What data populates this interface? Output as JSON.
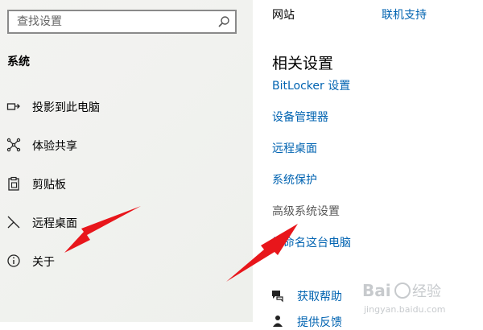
{
  "search": {
    "placeholder": "查找设置"
  },
  "sidebar": {
    "section_title": "系统",
    "items": [
      {
        "label": "投影到此电脑",
        "icon": "project-icon"
      },
      {
        "label": "体验共享",
        "icon": "share-icon"
      },
      {
        "label": "剪贴板",
        "icon": "clipboard-icon"
      },
      {
        "label": "远程桌面",
        "icon": "remote-desktop-icon"
      },
      {
        "label": "关于",
        "icon": "info-icon"
      }
    ]
  },
  "main": {
    "top_left": "网站",
    "top_link": "联机支持",
    "related_heading": "相关设置",
    "related_links": [
      "BitLocker 设置",
      "设备管理器",
      "远程桌面",
      "系统保护",
      "高级系统设置",
      "重命名这台电脑"
    ],
    "help": {
      "get_help": "获取帮助",
      "feedback": "提供反馈"
    }
  },
  "watermark": {
    "brand": "Baidu 经验",
    "url": "jingyan.baidu.com"
  },
  "colors": {
    "link": "#0063b1",
    "arrow": "#e8161b",
    "sidebar_bg": "#f2f2f0"
  }
}
